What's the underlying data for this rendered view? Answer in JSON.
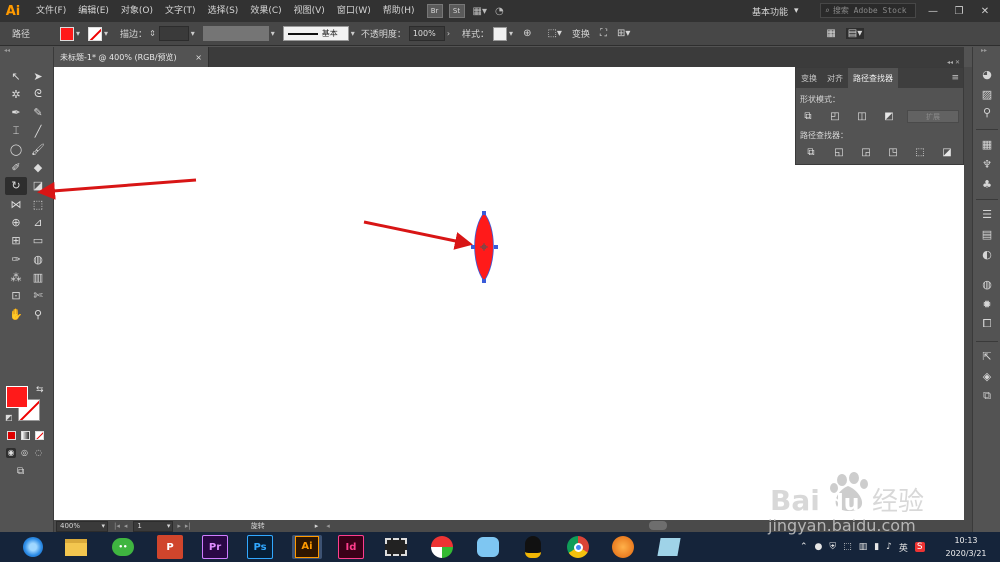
{
  "app": {
    "logo_text": "Ai"
  },
  "menubar": {
    "items": [
      "文件(F)",
      "编辑(E)",
      "对象(O)",
      "文字(T)",
      "选择(S)",
      "效果(C)",
      "视图(V)",
      "窗口(W)",
      "帮助(H)"
    ],
    "badges": [
      "Br",
      "St"
    ],
    "workspace_label": "基本功能",
    "stock_search_placeholder": "搜索 Adobe Stock"
  },
  "controlbar": {
    "selection_label": "路径",
    "fill_color": "#ff1a1a",
    "stroke_label": "描边：",
    "brush_label": "基本",
    "opacity_label": "不透明度：",
    "opacity_value": "100%",
    "style_label": "样式：",
    "transform_label": "变换"
  },
  "document": {
    "tab_title": "未标题-1* @ 400% (RGB/预览)",
    "close_glyph": "×"
  },
  "toolbar": {
    "fill_color": "#ff1a1a",
    "stroke_color": "#ffffff"
  },
  "panel": {
    "tabs": [
      "变换",
      "对齐",
      "路径查找器"
    ],
    "active_tab": 2,
    "shape_modes_label": "形状模式：",
    "expand_label": "扩展",
    "pathfinders_label": "路径查找器："
  },
  "statusbar": {
    "zoom": "400%",
    "page": "1",
    "tool_name": "旋转"
  },
  "taskbar": {
    "apps": [
      {
        "name": "browser-360",
        "label": ""
      },
      {
        "name": "file-explorer",
        "label": ""
      },
      {
        "name": "wechat",
        "label": ""
      },
      {
        "name": "powerpoint",
        "label": "P"
      },
      {
        "name": "premiere",
        "label": "Pr"
      },
      {
        "name": "photoshop",
        "label": "Ps"
      },
      {
        "name": "illustrator",
        "label": "Ai"
      },
      {
        "name": "indesign",
        "label": "Id"
      },
      {
        "name": "video-player",
        "label": ""
      },
      {
        "name": "umbrella-app",
        "label": ""
      },
      {
        "name": "cloud-app",
        "label": ""
      },
      {
        "name": "qq",
        "label": ""
      },
      {
        "name": "chrome",
        "label": ""
      },
      {
        "name": "fox-app",
        "label": ""
      },
      {
        "name": "notebook-app",
        "label": ""
      }
    ],
    "tray_lang": "英",
    "time": "10:13",
    "date": "2020/3/21"
  },
  "watermark": {
    "brand": "Bai du 经验",
    "url": "jingyan.baidu.com"
  },
  "colors": {
    "accent_red": "#ff1a1a",
    "arrow_red": "#d81515",
    "anchor_blue": "#3a5bd9"
  }
}
